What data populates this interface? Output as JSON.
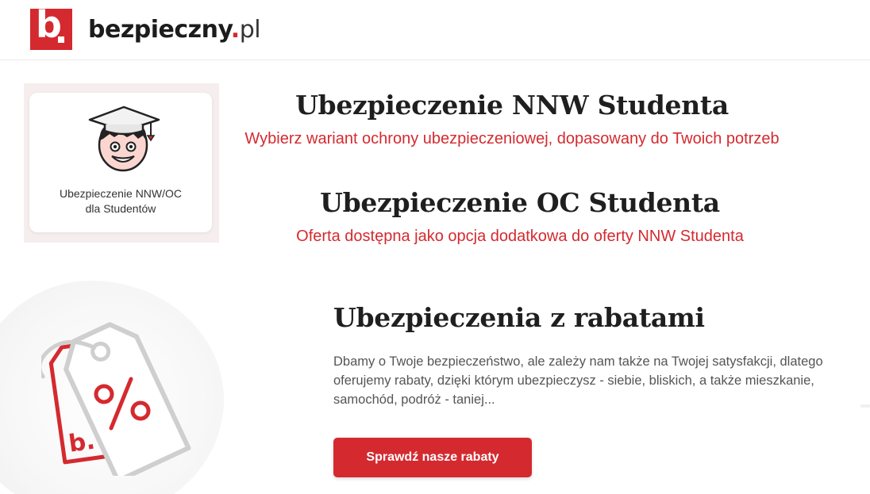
{
  "header": {
    "logo_mark": "b",
    "brand_name": "bezpieczny",
    "brand_dot": ".",
    "brand_tld": "pl"
  },
  "product_card": {
    "icon": "student-graduation-cap-icon",
    "label_line1": "Ubezpieczenie NNW/OC",
    "label_line2": "dla Studentów"
  },
  "nnw": {
    "title": "Ubezpieczenie NNW Studenta",
    "subtitle": "Wybierz wariant ochrony ubezpieczeniowej, dopasowany do Twoich potrzeb"
  },
  "oc": {
    "title": "Ubezpieczenie OC Studenta",
    "subtitle": "Oferta dostępna jako opcja dodatkowa do oferty NNW Studenta"
  },
  "discounts": {
    "illustration": "discount-tags-icon",
    "title": "Ubezpieczenia z rabatami",
    "description": "Dbamy o Twoje bezpieczeństwo, ale zależy nam także na Twojej satysfakcji, dlatego oferujemy rabaty, dzięki którym ubezpieczysz - siebie, bliskich, a także mieszkanie, samochód, podróż - taniej...",
    "button_label": "Sprawdź nasze rabaty"
  },
  "colors": {
    "brand_red": "#d42a2f",
    "text_dark": "#1f1f1f",
    "text_muted": "#555555"
  }
}
